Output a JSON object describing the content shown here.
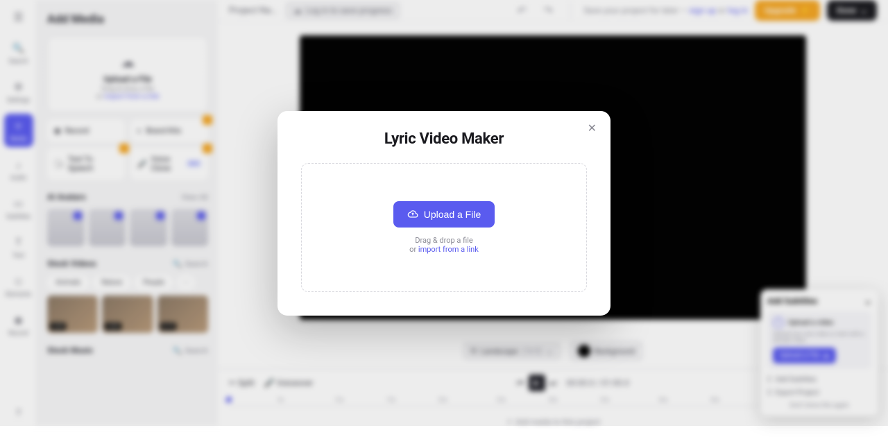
{
  "modal": {
    "title": "Lyric Video Maker",
    "upload_button": "Upload a File",
    "drag_text": "Drag & drop a file",
    "or_text": "or ",
    "import_link": "import from a link"
  },
  "left_rail": {
    "items": [
      {
        "label": "Search"
      },
      {
        "label": "Settings"
      },
      {
        "label": "Media"
      },
      {
        "label": "Audio"
      },
      {
        "label": "Subtitles"
      },
      {
        "label": "Text"
      },
      {
        "label": "Elements"
      },
      {
        "label": "Record"
      }
    ]
  },
  "left_panel": {
    "title": "Add Media",
    "upload_card": {
      "title": "Upload a File",
      "sub_drag": "Drag & drop a file",
      "sub_or": "or ",
      "sub_link": "import from a link"
    },
    "chips": {
      "record": "Record",
      "brand_kits": "Brand Kits",
      "tts": "Text To Speech",
      "voice_clone": "Voice Clone",
      "new_tag": "NEW"
    },
    "avatars": {
      "title": "AI Avatars",
      "view_all": "View All"
    },
    "stock_videos": {
      "title": "Stock Videos",
      "search": "Search",
      "pills": [
        "Animals",
        "Nature",
        "People"
      ],
      "thumbs": [
        "0:29",
        "0:29",
        "0:15"
      ]
    },
    "stock_music": {
      "title": "Stock Music",
      "search": "Search"
    }
  },
  "top_bar": {
    "project_name": "Project Na...",
    "log_in": "Log in to save progress",
    "save_prefix": "Save your project for later — ",
    "sign_up": "sign up",
    "or": " or ",
    "log_in_link": "log in",
    "upgrade": "Upgrade",
    "done": "Done"
  },
  "canvas_controls": {
    "landscape": "Landscape",
    "ratio": "(16:9)",
    "background": "Background"
  },
  "timeline": {
    "split": "Split",
    "voiceover": "Voiceover",
    "current_time": "00:00.0",
    "total_time": "01:00.0",
    "ticks": [
      "5s",
      "10s",
      "15s",
      "20s",
      "25s",
      "30s",
      "35s",
      "40s",
      "45s",
      "50s",
      "55s"
    ],
    "empty": "Add media to this project"
  },
  "subtitles_panel": {
    "title": "Add Subtitles",
    "step1_label": "Upload a video",
    "step1_sub": "Upload your own video or start with a sample video.",
    "upload": "Upload a File",
    "step2": "Add Subtitles",
    "step3": "Export Project",
    "dismiss": "Don't show this again"
  }
}
